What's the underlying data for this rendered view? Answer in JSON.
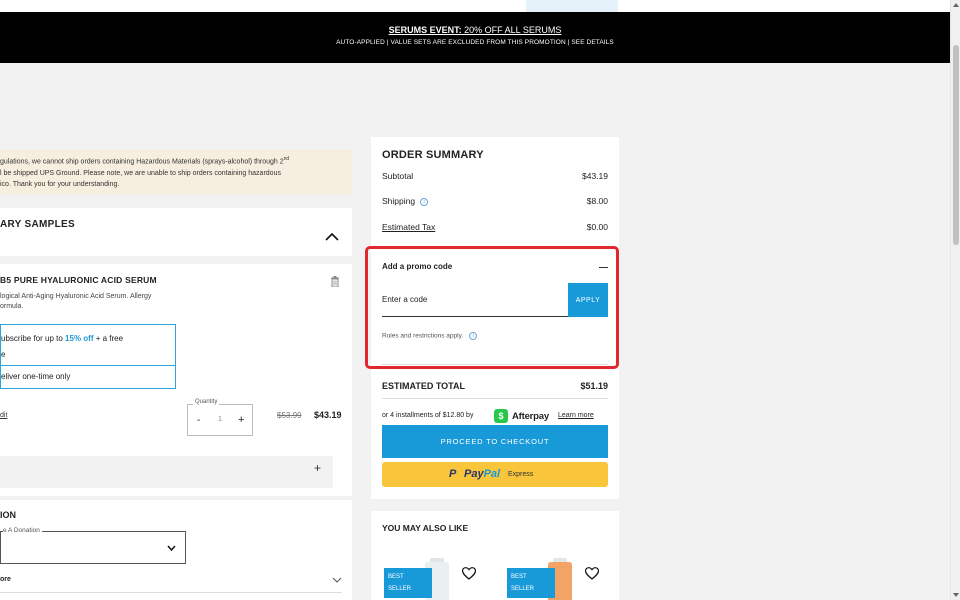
{
  "banner": {
    "headline_bold": "SERUMS EVENT:",
    "headline_rest": " 20% OFF ALL SERUMS",
    "subline": "AUTO-APPLIED | VALUE SETS ARE EXCLUDED FROM THIS PROMOTION | SEE DETAILS"
  },
  "hazard_notice": {
    "line1": "gulations, we cannot ship orders containing Hazardous Materials (sprays-alcohol) through 2",
    "line1_sup": "nd",
    "line2": "l be shipped UPS Ground. Please note, we are unable to ship orders containing hazardous",
    "line3": "ico. Thank you for your understanding."
  },
  "samples": {
    "title": "ARY SAMPLES"
  },
  "product": {
    "name": "B5 PURE HYALURONIC ACID SERUM",
    "desc_line1": "logical Anti-Aging Hyaluronic Acid Serum. Allergy",
    "desc_line2": "ormula.",
    "subscribe_pre": "ubscribe for up to ",
    "subscribe_pct": "15% off",
    "subscribe_post": " + a free",
    "subscribe_line2": "e",
    "one_time": "eliver one-time only",
    "edit_link": "dit",
    "quantity_label": "Quantity",
    "quantity_minus": "-",
    "quantity_value": "1",
    "quantity_plus": "+",
    "price_old": "$53.99",
    "price_new": "$43.19",
    "addon_plus": "+"
  },
  "donation": {
    "title": "ION",
    "select_label": "e A Donation",
    "more_label": "ore"
  },
  "summary": {
    "title": "ORDER SUMMARY",
    "subtotal_label": "Subtotal",
    "subtotal_value": "$43.19",
    "shipping_label": "Shipping",
    "shipping_value": "$8.00",
    "tax_label": "Estimated Tax",
    "tax_value": "$0.00",
    "info_glyph": "i"
  },
  "promo": {
    "title": "Add a promo code",
    "placeholder": "Enter a code",
    "apply_label": "APPLY",
    "rules_text": "Rules and restrictions apply."
  },
  "total": {
    "label": "ESTIMATED TOTAL",
    "value": "$51.19"
  },
  "afterpay": {
    "text": "or 4 installments of $12.80 by",
    "logo_glyph": "$",
    "brand": "Afterpay",
    "learn_more": "Learn more"
  },
  "checkout": {
    "proceed_label": "PROCEED TO CHECKOUT",
    "paypal_mark": "P",
    "paypal_pay": "Pay",
    "paypal_pal": "Pal",
    "paypal_express": "Express"
  },
  "also_like": {
    "title": "YOU MAY ALSO LIKE",
    "items": [
      {
        "badge_line1": "BEST",
        "badge_line2": "SELLER"
      },
      {
        "badge_line1": "BEST",
        "badge_line2": "SELLER"
      }
    ]
  },
  "colors": {
    "accent": "#189ad9",
    "banner": "#000000",
    "highlight_frame": "#e0282e",
    "paypal": "#f9c53b",
    "afterpay": "#2ac84a"
  }
}
